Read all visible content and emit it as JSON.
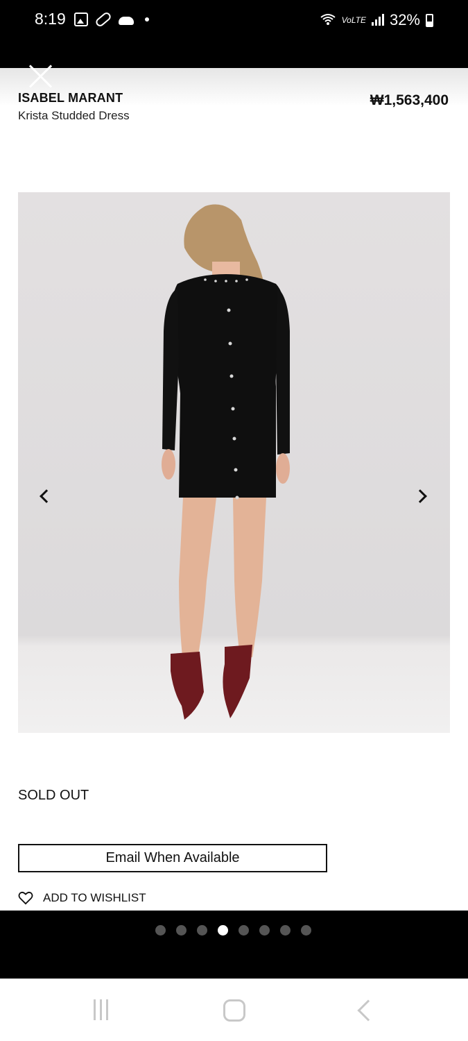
{
  "status_bar": {
    "time": "8:19",
    "network": "VoLTE",
    "battery": "32%",
    "icons": [
      "gallery-icon",
      "pill-icon",
      "cloud-icon",
      "notification-dot-icon",
      "wifi-icon",
      "signal-icon",
      "battery-icon"
    ]
  },
  "product": {
    "brand": "ISABEL MARANT",
    "name": "Krista Studded Dress",
    "price": "₩1,563,400",
    "availability": "SOLD OUT",
    "email_button": "Email When Available",
    "wishlist_label": "ADD TO WISHLIST"
  },
  "gallery": {
    "image_count": 8,
    "active_index": 3,
    "icons": [
      "close-icon",
      "chevron-left-icon",
      "chevron-right-icon",
      "heart-icon"
    ]
  },
  "nav_bar": {
    "icons": [
      "recents-icon",
      "home-icon",
      "back-icon"
    ]
  }
}
